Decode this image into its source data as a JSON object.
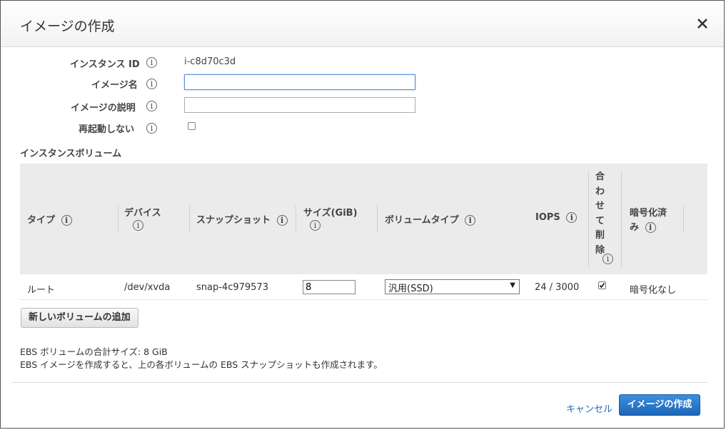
{
  "dialog": {
    "title": "イメージの作成"
  },
  "form": {
    "instance_id": {
      "label": "インスタンス ID",
      "value": "i-c8d70c3d"
    },
    "image_name": {
      "label": "イメージ名",
      "value": "",
      "placeholder": ""
    },
    "image_description": {
      "label": "イメージの説明",
      "value": "",
      "placeholder": ""
    },
    "no_reboot": {
      "label": "再起動しない",
      "checked": false
    }
  },
  "volumes": {
    "section_title": "インスタンスボリューム",
    "columns": {
      "type": "タイプ",
      "device": "デバイス",
      "snapshot": "スナップショット",
      "size": "サイズ(GiB)",
      "volume_type": "ボリュームタイプ",
      "iops": "IOPS",
      "delete_on_termination": [
        "合",
        "わ",
        "せ",
        "て",
        "削",
        "除"
      ],
      "encrypted_line1": "暗号化済",
      "encrypted_line2": "み"
    },
    "rows": [
      {
        "type": "ルート",
        "device": "/dev/xvda",
        "snapshot": "snap-4c979573",
        "size": "8",
        "volume_type": "汎用(SSD)",
        "iops": "24 / 3000",
        "delete_on_termination": true,
        "encrypted": "暗号化なし"
      }
    ],
    "add_button": "新しいボリュームの追加"
  },
  "summary": {
    "total_size": "EBS ボリュームの合計サイズ: 8 GiB",
    "note": "EBS イメージを作成すると、上の各ボリュームの EBS スナップショットも作成されます。"
  },
  "footer": {
    "cancel": "キャンセル",
    "create": "イメージの作成"
  },
  "icons": {
    "info": "i"
  },
  "colors": {
    "primary_button": "#2a7acb",
    "link": "#1a6fbf",
    "table_header_bg": "#ebebeb"
  }
}
